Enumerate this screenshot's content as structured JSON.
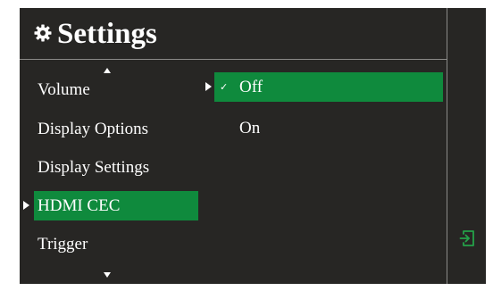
{
  "title": "Settings",
  "icons": {
    "title": "gear-icon",
    "exit": "exit-icon",
    "scroll_up": "chevron-up-icon",
    "scroll_down": "chevron-down-icon",
    "pointer": "pointer-triangle-icon",
    "check": "checkmark-icon"
  },
  "menu": {
    "items": [
      {
        "label": "Volume"
      },
      {
        "label": "Display Options"
      },
      {
        "label": "Display Settings"
      },
      {
        "label": "HDMI CEC"
      },
      {
        "label": "Trigger"
      }
    ],
    "selected": "HDMI CEC"
  },
  "options": {
    "items": [
      {
        "label": "Off",
        "check": "✓"
      },
      {
        "label": "On",
        "check": ""
      }
    ],
    "selected": "Off"
  },
  "colors": {
    "panel_bg": "#272624",
    "highlight": "#0f8a3d",
    "divider": "#8a8a88",
    "text": "#ffffff",
    "exit_icon": "#24a249"
  }
}
